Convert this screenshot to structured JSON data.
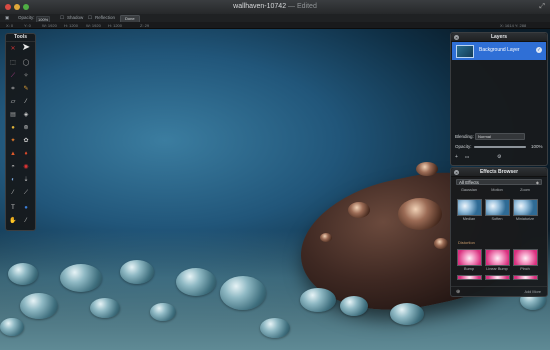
{
  "window": {
    "title": "wallhaven-10742",
    "edited": " — Edited",
    "fullscreen_icon": "fullscreen-arrows-icon"
  },
  "toolbar": {
    "selection_icon": "selection-options-icon",
    "opacity_label": "Opacity:",
    "opacity_value": "100%",
    "shadow_label": "Shadow",
    "reflection_label": "Reflection",
    "done_label": "Done"
  },
  "infobar": {
    "x": "X: 0",
    "y": "Y: 0",
    "w": "W: 1920",
    "h": "H: 1200",
    "w2": "W: 1920",
    "h2": "H: 1200",
    "zoom": "Z: 29",
    "coords": "X: 1614 Y: 288"
  },
  "tools": {
    "title": "Tools",
    "items": [
      "move-arrow-icon",
      "move-tool-icon",
      "rect-select-icon",
      "ellipse-select-icon",
      "lasso-icon",
      "magic-wand-icon",
      "crop-icon",
      "eyedropper-icon",
      "eraser-icon",
      "brush-icon",
      "gradient-icon",
      "paint-bucket-icon",
      "shape-icon",
      "stamp-icon",
      "burn-icon",
      "sponge-icon",
      "smudge-icon",
      "blur-icon",
      "sharpen-icon",
      "red-eye-icon",
      "type-icon",
      "dodge-icon",
      "pen-icon",
      "color-swatch-icon",
      "hand-icon",
      "zoom-icon"
    ]
  },
  "layers": {
    "title": "Layers",
    "layer_name": "Background Layer",
    "blending_label": "Blending:",
    "blending_value": "Normal",
    "opacity_label": "Opacity:",
    "opacity_value": "100%",
    "opacity_fraction": 1.0,
    "add_icon": "+",
    "more_icon": "•••",
    "gear_icon": "gear-icon"
  },
  "effects": {
    "title": "Effects Browser",
    "category": "All Effects",
    "row1": [
      "Gaussian",
      "Motion",
      "Zoom"
    ],
    "row2": [
      "Median",
      "Soften",
      "Miniaturize"
    ],
    "section": "Distortion",
    "row3": [
      "Bump",
      "Linear Bump",
      "Pinch"
    ],
    "more_label": "Add More"
  },
  "colors": {
    "accent": "#2f6fd6",
    "panel_bg": "#18191b"
  }
}
